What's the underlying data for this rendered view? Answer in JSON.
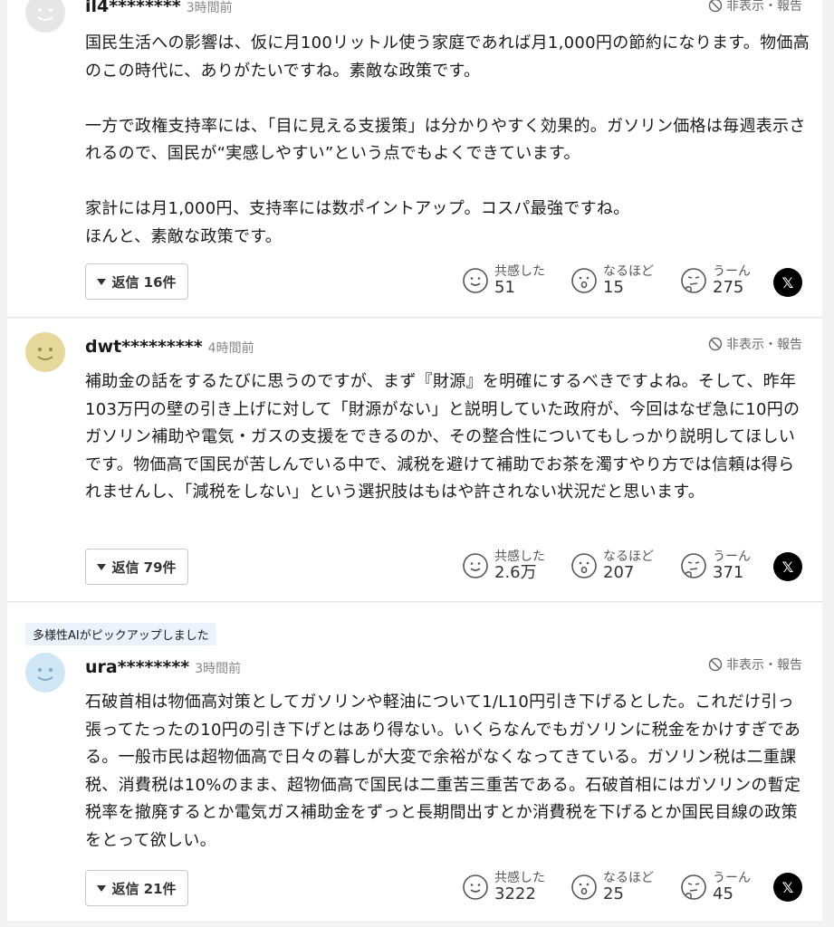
{
  "comments": [
    {
      "username": "il4********",
      "time": "3時間前",
      "hide_report": "非表示・報告",
      "body": "国民生活への影響は、仮に月100リットル使う家庭であれば月1,000円の節約になります。物価高のこの時代に、ありがたいですね。素敵な政策です。\n\n一方で政権支持率には、「目に見える支援策」は分かりやすく効果的。ガソリン価格は毎週表示されるので、国民が“実感しやすい”という点でもよくできています。\n\n家計には月1,000円、支持率には数ポイントアップ。コスパ最強ですね。\nほんと、素敵な政策です。",
      "reply_label": "返信 16件",
      "reactions": [
        {
          "label": "共感した",
          "count": "51",
          "icon": "smile-icon"
        },
        {
          "label": "なるほど",
          "count": "15",
          "icon": "surprised-icon"
        },
        {
          "label": "うーん",
          "count": "275",
          "icon": "thinking-icon"
        }
      ],
      "avatar_color": "#e6e6e6"
    },
    {
      "username": "dwt*********",
      "time": "4時間前",
      "hide_report": "非表示・報告",
      "body": "補助金の話をするたびに思うのですが、まず『財源』を明確にするべきですよね。そして、昨年103万円の壁の引き上げに対して「財源がない」と説明していた政府が、今回はなぜ急に10円のガソリン補助や電気・ガスの支援をできるのか、その整合性についてもしっかり説明してほしいです。物価高で国民が苦しんでいる中で、減税を避けて補助でお茶を濁すやり方では信頼は得られませんし、「減税をしない」という選択肢はもはや許されない状況だと思います。",
      "reply_label": "返信 79件",
      "reactions": [
        {
          "label": "共感した",
          "count": "2.6万",
          "icon": "smile-icon"
        },
        {
          "label": "なるほど",
          "count": "207",
          "icon": "surprised-icon"
        },
        {
          "label": "うーん",
          "count": "371",
          "icon": "thinking-icon"
        }
      ],
      "avatar_color": "#e6d89a"
    },
    {
      "badge": "多様性AIがピックアップしました",
      "username": "ura********",
      "time": "3時間前",
      "hide_report": "非表示・報告",
      "body": "石破首相は物価高対策としてガソリンや軽油について1/L10円引き下げるとした。これだけ引っ張ってたったの10円の引き下げとはあり得ない。いくらなんでもガソリンに税金をかけすぎである。一般市民は超物価高で日々の暮しが大変で余裕がなくなってきている。ガソリン税は二重課税、消費税は10%のまま、超物価高で国民は二重苦三重苦である。石破首相にはガソリンの暫定税率を撤廃するとか電気ガス補助金をずっと長期間出すとか消費税を下げるとか国民目線の政策をとって欲しい。",
      "reply_label": "返信 21件",
      "reactions": [
        {
          "label": "共感した",
          "count": "3222",
          "icon": "smile-icon"
        },
        {
          "label": "なるほど",
          "count": "25",
          "icon": "surprised-icon"
        },
        {
          "label": "うーん",
          "count": "45",
          "icon": "thinking-icon"
        }
      ],
      "avatar_color": "#cfe6f4"
    }
  ],
  "share_x_label": "𝕏"
}
